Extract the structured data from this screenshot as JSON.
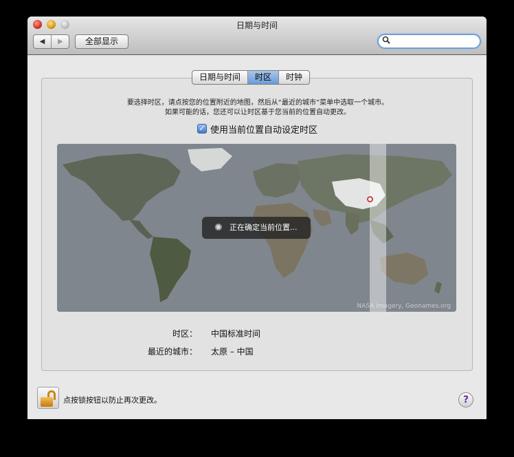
{
  "window": {
    "title": "日期与时间"
  },
  "toolbar": {
    "back_icon": "◀",
    "forward_icon": "▶",
    "show_all_label": "全部显示",
    "search_placeholder": "",
    "search_icon": "magnifier-icon"
  },
  "tabs": [
    {
      "label": "日期与时间",
      "active": false
    },
    {
      "label": "时区",
      "active": true
    },
    {
      "label": "时钟",
      "active": false
    }
  ],
  "instructions": {
    "line1": "要选择时区，请点按您的位置附近的地图，然后从“最近的城市”菜单中选取一个城市。",
    "line2": "如果可能的话，您还可以让时区基于您当前的位置自动更改。"
  },
  "auto_timezone": {
    "checked": true,
    "label": "使用当前位置自动设定时区"
  },
  "map": {
    "status": "正在确定当前位置...",
    "credit": "NASA Imagery, Geonames.org"
  },
  "info": {
    "timezone_label": "时区：",
    "timezone_value": "中国标准时间",
    "city_label": "最近的城市：",
    "city_value": "太原 – 中国"
  },
  "footer": {
    "lock_text": "点按锁按钮以防止再次更改。",
    "help_label": "?"
  }
}
